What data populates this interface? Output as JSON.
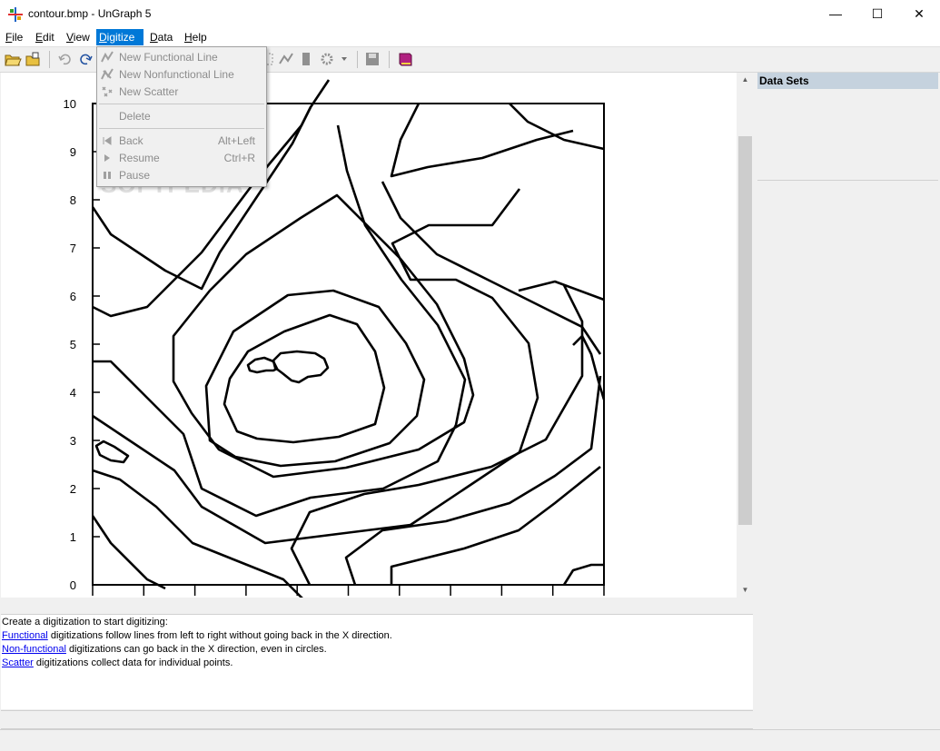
{
  "window": {
    "title": "contour.bmp - UnGraph 5",
    "minimize_glyph": "—",
    "maximize_glyph": "☐",
    "close_glyph": "✕"
  },
  "menu": [
    {
      "label": "File",
      "mnemonic": "F",
      "rest": "ile"
    },
    {
      "label": "Edit",
      "mnemonic": "E",
      "rest": "dit"
    },
    {
      "label": "View",
      "mnemonic": "V",
      "rest": "iew"
    },
    {
      "label": "Digitize",
      "mnemonic": "D",
      "rest": "igitize"
    },
    {
      "label": "Data",
      "mnemonic": "D",
      "rest": "ata"
    },
    {
      "label": "Help",
      "mnemonic": "H",
      "rest": "elp"
    }
  ],
  "digitize_menu": {
    "items": [
      {
        "label": "New Functional Line",
        "icon": "functional-line-icon"
      },
      {
        "label": "New Nonfunctional Line",
        "icon": "nonfunctional-line-icon"
      },
      {
        "label": "New Scatter",
        "icon": "scatter-icon"
      },
      {
        "label": "Delete",
        "icon": ""
      },
      {
        "label": "Back",
        "shortcut": "Alt+Left",
        "icon": "back-icon"
      },
      {
        "label": "Resume",
        "shortcut": "Ctrl+R",
        "icon": "resume-icon"
      },
      {
        "label": "Pause",
        "icon": "pause-icon"
      }
    ]
  },
  "toolbar": {
    "icons": [
      "open-folder-icon",
      "open-file-icon",
      "undo-icon",
      "redo-icon",
      "select-icon",
      "digitize-icon",
      "bar-icon",
      "settings-icon",
      "save-icon",
      "help-book-icon"
    ]
  },
  "plot": {
    "y_ticks": [
      "10",
      "9",
      "8",
      "7",
      "6",
      "5",
      "4",
      "3",
      "2",
      "1",
      "0"
    ],
    "y_min": 0,
    "y_max": 10
  },
  "watermark": "SOFTPEDIA",
  "side_panel": {
    "header": "Data Sets"
  },
  "info": {
    "line1": "Create a digitization to start digitizing:",
    "functional_link": "Functional",
    "functional_text": " digitizations follow lines from left to right without going back in the X direction.",
    "nonfunctional_link": "Non-functional",
    "nonfunctional_text": " digitizations can go back in the X direction, even in circles.",
    "scatter_link": "Scatter",
    "scatter_text": " digitizations collect data for individual points."
  },
  "colors": {
    "accent": "#0078d7",
    "side_header": "#c5d2de",
    "link": "#0000ee"
  }
}
